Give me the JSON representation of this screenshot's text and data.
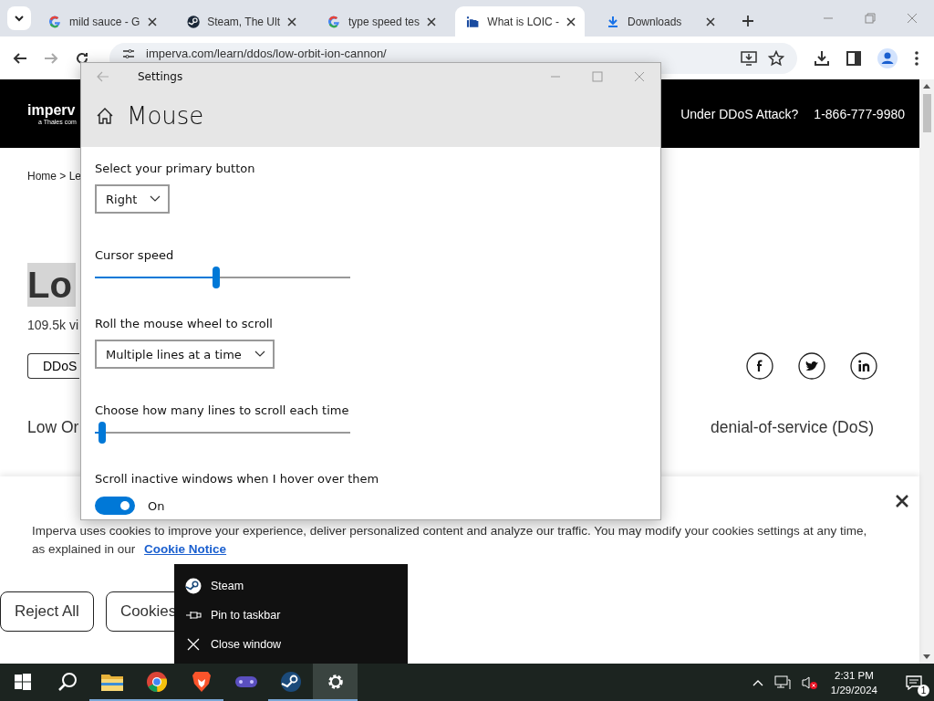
{
  "browser": {
    "tabs": [
      {
        "kind": "g",
        "title": "mild sauce - G",
        "selected": false
      },
      {
        "kind": "steam",
        "title": "Steam, The Ult",
        "selected": false
      },
      {
        "kind": "g",
        "title": "type speed tes",
        "selected": false
      },
      {
        "kind": "im",
        "title": "What is LOIC -",
        "selected": true
      },
      {
        "kind": "download",
        "title": "Downloads",
        "selected": false
      }
    ],
    "address": "imperva.com/learn/ddos/low-orbit-ion-cannon/"
  },
  "page": {
    "logo": "imperv",
    "logo_sub": "a Thales com",
    "cta": "Under DDoS Attack?",
    "phone": "1-866-777-9980",
    "breadcrumb": "Home > Le",
    "heading": "Lo",
    "views": "109.5k vi",
    "tag": "DDoS",
    "intro_left": "Low Or",
    "intro_right": "denial-of-service (DoS)"
  },
  "settings": {
    "title": "Settings",
    "heading": "Mouse",
    "controls": [
      {
        "kind": "dropdown",
        "label": "Select your primary button",
        "value": "Right"
      },
      {
        "kind": "slider",
        "label": "Cursor speed",
        "level": 0.475
      },
      {
        "kind": "dropdown",
        "label": "Roll the mouse wheel to scroll",
        "value": "Multiple lines at a time"
      },
      {
        "kind": "slider",
        "label": "Choose how many lines to scroll each time",
        "level": 0.03
      },
      {
        "kind": "toggle",
        "label": "Scroll inactive windows when I hover over them",
        "on": true,
        "state_text": "On"
      }
    ]
  },
  "cookie_banner": {
    "text": "Imperva uses cookies to improve your experience, deliver personalized content and analyze our traffic. You may modify your cookies settings at any time, as explained in our",
    "link": "Cookie Notice",
    "buttons": [
      "Reject All",
      "Cookies"
    ]
  },
  "jump_list": [
    {
      "kind": "steam",
      "label": "Steam"
    },
    {
      "kind": "pin",
      "label": "Pin to taskbar"
    },
    {
      "kind": "close",
      "label": "Close window"
    }
  ],
  "taskbar": {
    "apps": [
      {
        "kind": "start",
        "running": false,
        "selected": false
      },
      {
        "kind": "search",
        "running": false,
        "selected": false
      },
      {
        "kind": "folder",
        "running": true,
        "selected": false
      },
      {
        "kind": "chrome",
        "running": true,
        "selected": false
      },
      {
        "kind": "brave",
        "running": true,
        "selected": false
      },
      {
        "kind": "game",
        "running": false,
        "selected": false
      },
      {
        "kind": "steam",
        "running": true,
        "selected": false
      },
      {
        "kind": "settings",
        "running": true,
        "selected": true
      }
    ],
    "time": "2:31 PM",
    "date": "1/29/2024",
    "notifications": "1"
  }
}
